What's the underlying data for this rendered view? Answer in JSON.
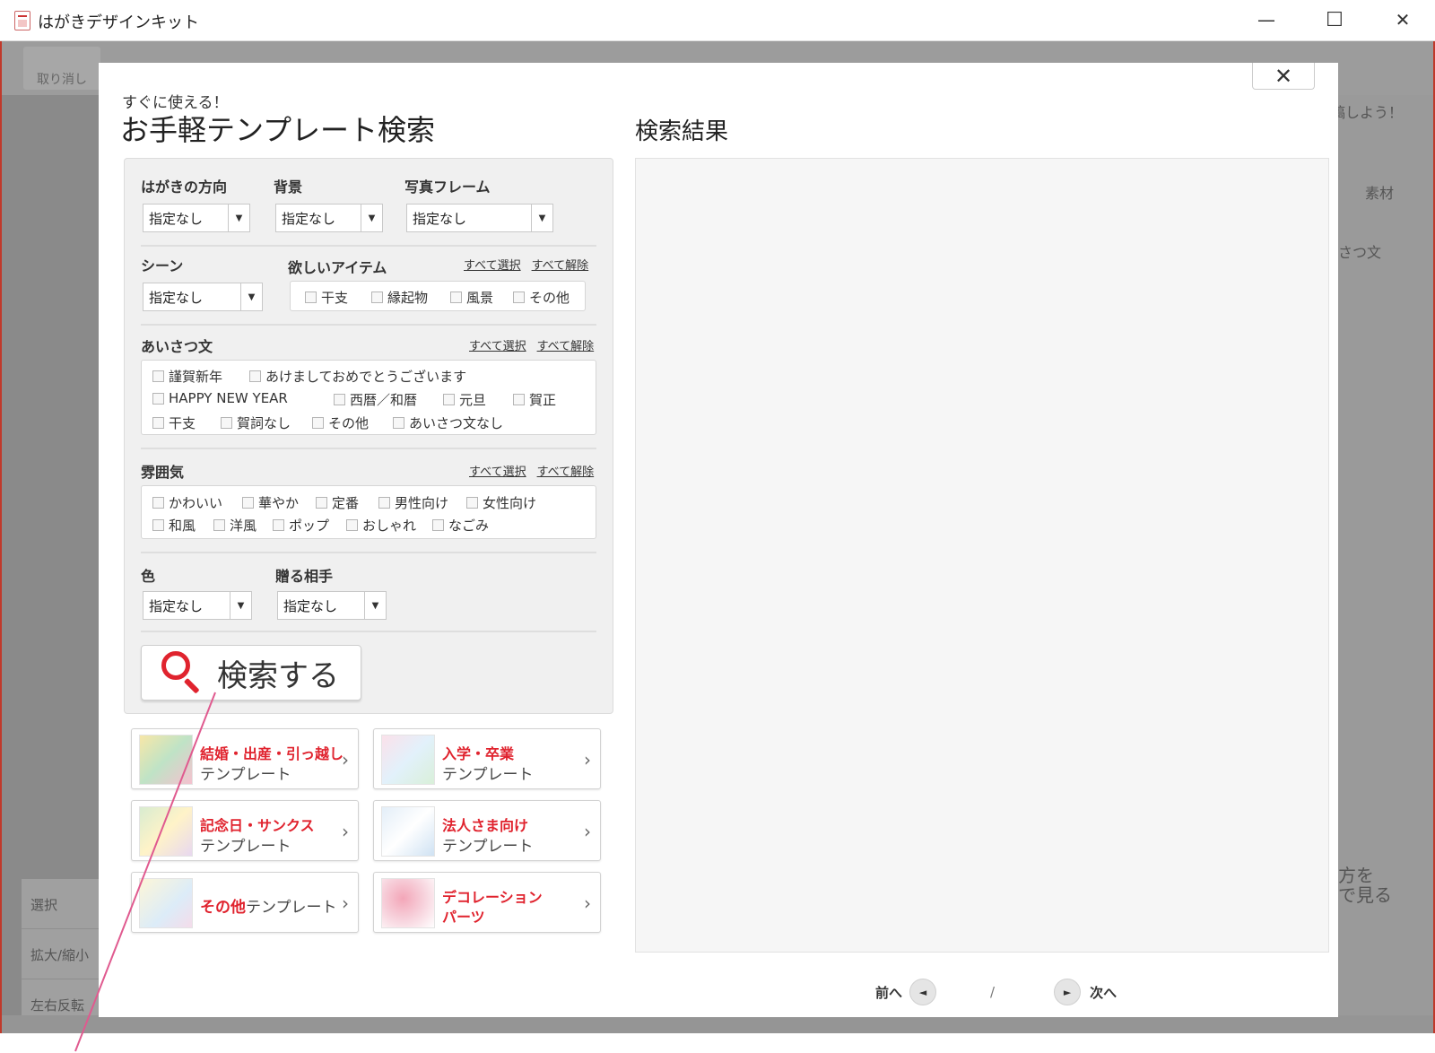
{
  "window": {
    "title": "はがきデザインキット",
    "minimize": "—",
    "maximize": "☐",
    "close": "✕"
  },
  "background": {
    "undo_label": "取り消し",
    "left_tools": [
      "選択",
      "拡大/縮小",
      "左右反転"
    ],
    "right_texts": [
      "稿しよう！",
      "素材",
      "さつ文",
      "方を",
      "で見る"
    ]
  },
  "dialog": {
    "subtitle": "すぐに使える！",
    "title": "お手軽テンプレート検索",
    "close_label": "✕",
    "results_title": "検索結果",
    "filters": {
      "orientation": {
        "label": "はがきの方向",
        "value": "指定なし"
      },
      "background": {
        "label": "背景",
        "value": "指定なし"
      },
      "photo_frame": {
        "label": "写真フレーム",
        "value": "指定なし"
      },
      "scene": {
        "label": "シーン",
        "value": "指定なし"
      },
      "items": {
        "label": "欲しいアイテム",
        "options": [
          "干支",
          "縁起物",
          "風景",
          "その他"
        ]
      },
      "greeting": {
        "label": "あいさつ文",
        "options": [
          "謹賀新年",
          "あけましておめでとうございます",
          "HAPPY NEW YEAR",
          "西暦／和暦",
          "元旦",
          "賀正",
          "干支",
          "賀詞なし",
          "その他",
          "あいさつ文なし"
        ]
      },
      "mood": {
        "label": "雰囲気",
        "options": [
          "かわいい",
          "華やか",
          "定番",
          "男性向け",
          "女性向け",
          "和風",
          "洋風",
          "ポップ",
          "おしゃれ",
          "なごみ"
        ]
      },
      "color": {
        "label": "色",
        "value": "指定なし"
      },
      "recipient": {
        "label": "贈る相手",
        "value": "指定なし"
      },
      "select_all": "すべて選択",
      "clear_all": "すべて解除"
    },
    "search_button": "検索する",
    "templates": [
      {
        "title": "結婚・出産・引っ越し",
        "sub": "テンプレート"
      },
      {
        "title": "入学・卒業",
        "sub": "テンプレート"
      },
      {
        "title": "記念日・サンクス",
        "sub": "テンプレート"
      },
      {
        "title": "法人さま向け",
        "sub": "テンプレート"
      },
      {
        "title": "その他",
        "sub": "テンプレート"
      },
      {
        "title": "デコレーション",
        "sub": "パーツ"
      }
    ],
    "pager": {
      "prev": "前へ",
      "next": "次へ",
      "separator": "/",
      "prev_icon": "◄",
      "next_icon": "►"
    }
  },
  "colors": {
    "accent": "#e0232e",
    "frame": "#c0392b",
    "annotation": "#e05a8f"
  }
}
